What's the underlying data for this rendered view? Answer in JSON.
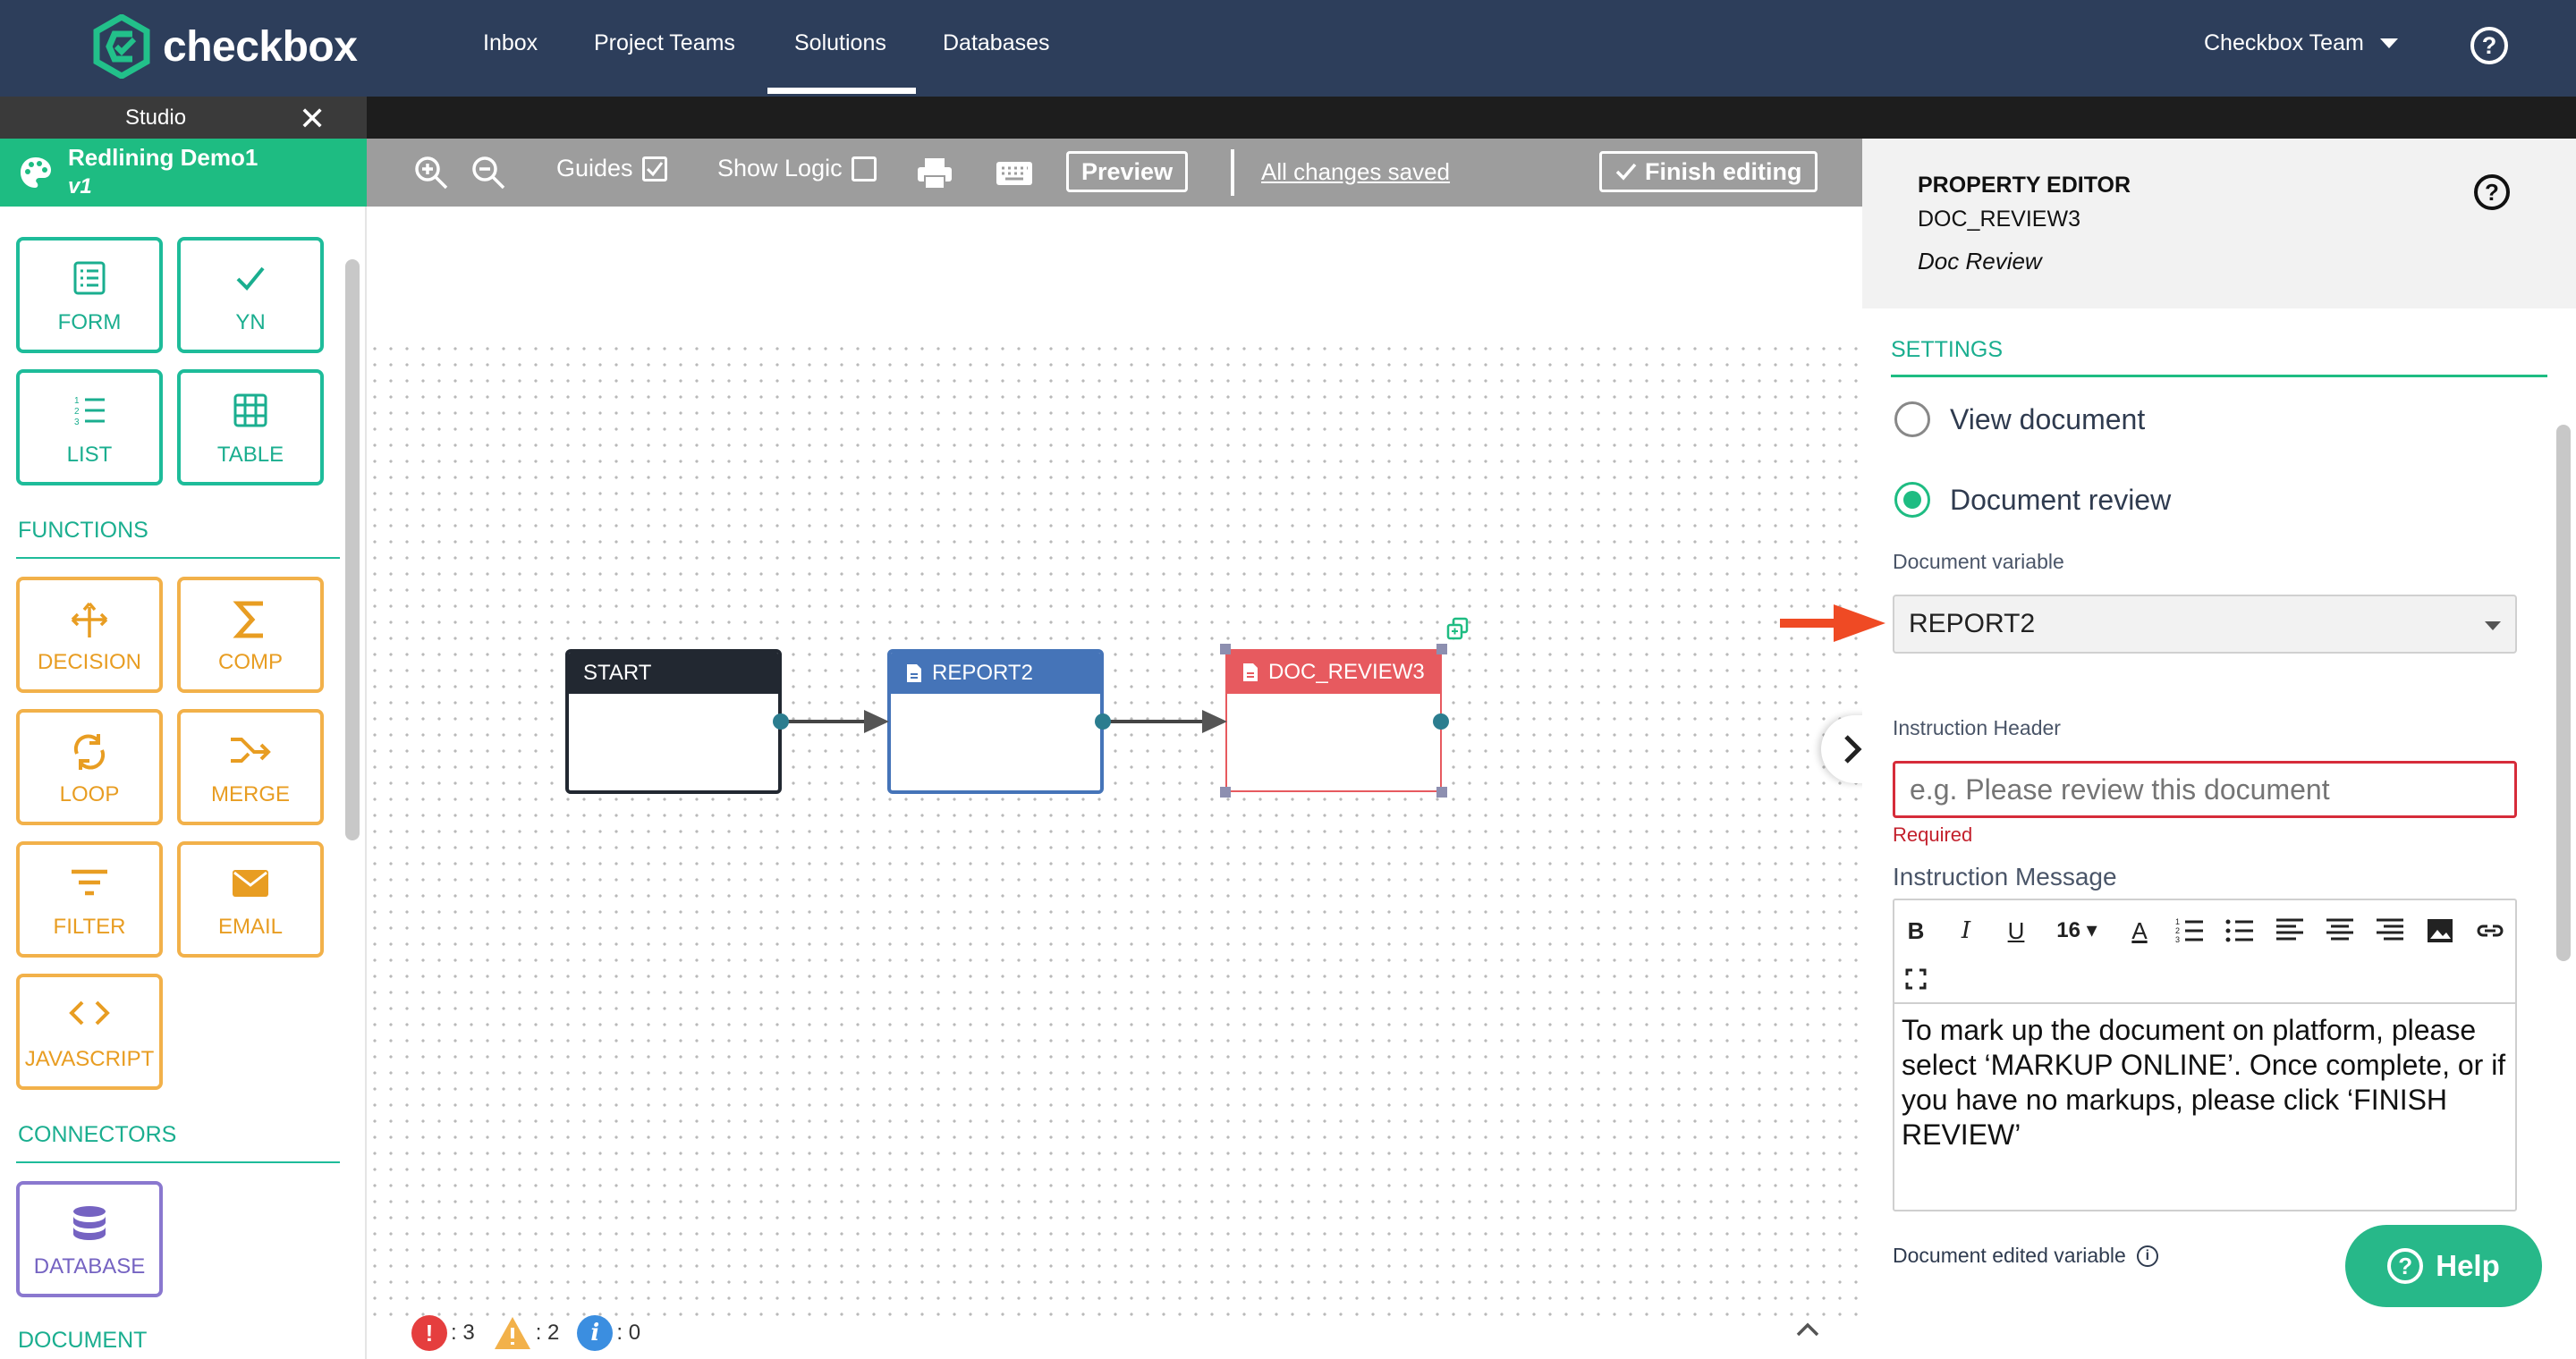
{
  "app": {
    "brand": "checkbox",
    "nav": [
      "Inbox",
      "Project Teams",
      "Solutions",
      "Databases"
    ],
    "active_nav": "Solutions",
    "team": "Checkbox Team"
  },
  "studio": {
    "tab_label": "Studio"
  },
  "project": {
    "name": "Redlining Demo1",
    "version": "v1"
  },
  "palette": {
    "top_tiles": [
      "FORM",
      "YN",
      "LIST",
      "TABLE"
    ],
    "functions_title": "FUNCTIONS",
    "function_tiles": [
      "DECISION",
      "COMP",
      "LOOP",
      "MERGE",
      "FILTER",
      "EMAIL",
      "JAVASCRIPT"
    ],
    "connectors_title": "CONNECTORS",
    "connector_tiles": [
      "DATABASE"
    ],
    "document_title": "DOCUMENT"
  },
  "toolbar": {
    "guides": "Guides",
    "show_logic": "Show Logic",
    "preview": "Preview",
    "saved": "All changes saved",
    "finish": "Finish editing"
  },
  "canvas": {
    "nodes": [
      {
        "id": "start",
        "label": "START",
        "color": "#222831"
      },
      {
        "id": "report2",
        "label": "REPORT2",
        "color": "#4574b8"
      },
      {
        "id": "doc_review3",
        "label": "DOC_REVIEW3",
        "color": "#e75a5f"
      }
    ],
    "status": {
      "errors": ": 3",
      "warnings": ": 2",
      "info": ": 0"
    }
  },
  "property_editor": {
    "title": "PROPERTY EDITOR",
    "element_id": "DOC_REVIEW3",
    "element_type": "Doc Review",
    "settings_title": "SETTINGS",
    "radio_options": [
      "View document",
      "Document review"
    ],
    "selected_option": "Document review",
    "document_variable_label": "Document variable",
    "document_variable_value": "REPORT2",
    "instruction_header_label": "Instruction Header",
    "instruction_header_placeholder": "e.g. Please review this document",
    "required_text": "Required",
    "instruction_message_label": "Instruction Message",
    "font_size": "16",
    "instruction_message": "To mark up the document on platform, please select ‘MARKUP ONLINE’. Once complete, or if you have no markups, please click ‘FINISH REVIEW’",
    "edited_variable_label": "Document edited variable"
  },
  "help_button": "Help",
  "colors": {
    "nav": "#2d3e5b",
    "accent": "#1ebc82",
    "error": "#d62c3a",
    "orange": "#f2b14a",
    "purple": "#8a78cf"
  }
}
